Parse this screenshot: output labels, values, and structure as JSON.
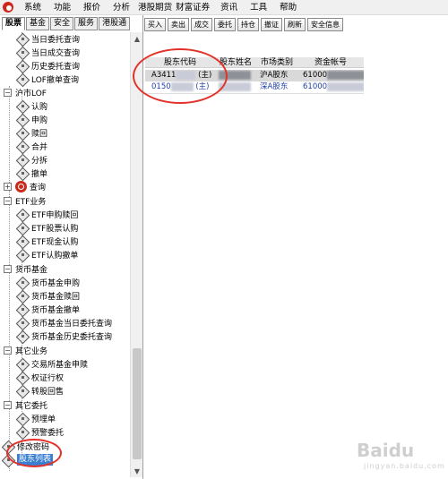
{
  "menubar": {
    "items": [
      "系统",
      "功能",
      "报价",
      "分析",
      "港股期货",
      "财富证券",
      "资讯",
      "工具",
      "帮助"
    ]
  },
  "category_tabs": [
    "股票",
    "基金",
    "安全",
    "服务",
    "港股通"
  ],
  "tree": {
    "items_top": [
      "当日委托查询",
      "当日成交查询",
      "历史委托查询",
      "LOF撤单查询"
    ],
    "sh_lof": {
      "label": "沪市LOF",
      "items": [
        "认购",
        "申购",
        "赎回",
        "合并",
        "分拆",
        "撤单"
      ]
    },
    "query": "查询",
    "etf": {
      "label": "ETF业务",
      "items": [
        "ETF申购赎回",
        "ETF股票认购",
        "ETF现金认购",
        "ETF认购撤单"
      ]
    },
    "money_fund": {
      "label": "货币基金",
      "items": [
        "货币基金申购",
        "货币基金赎回",
        "货币基金撤单",
        "货币基金当日委托查询",
        "货币基金历史委托查询"
      ]
    },
    "other_biz": {
      "label": "其它业务",
      "items": [
        "交易所基金申赎",
        "权证行权",
        "转股回售"
      ]
    },
    "other_entrust": {
      "label": "其它委托",
      "items": [
        "预埋单",
        "预警委托"
      ]
    },
    "change_password": "修改密码",
    "shareholder_list": "股东列表"
  },
  "toolbar": [
    "买入",
    "卖出",
    "成交",
    "委托",
    "持仓",
    "撤证",
    "刷新",
    "安全信息"
  ],
  "grid": {
    "headers": [
      "股东代码",
      "股东姓名",
      "市场类别",
      "资金帐号"
    ],
    "rows": [
      {
        "code": "A3411",
        "tag": "(主)",
        "market": "沪A股东",
        "account": "61000"
      },
      {
        "code": "0150",
        "tag": "(主)",
        "market": "深A股东",
        "account": "61000"
      }
    ]
  },
  "watermark": {
    "main": "Baidu",
    "sub": "jingyan.baidu.com"
  }
}
